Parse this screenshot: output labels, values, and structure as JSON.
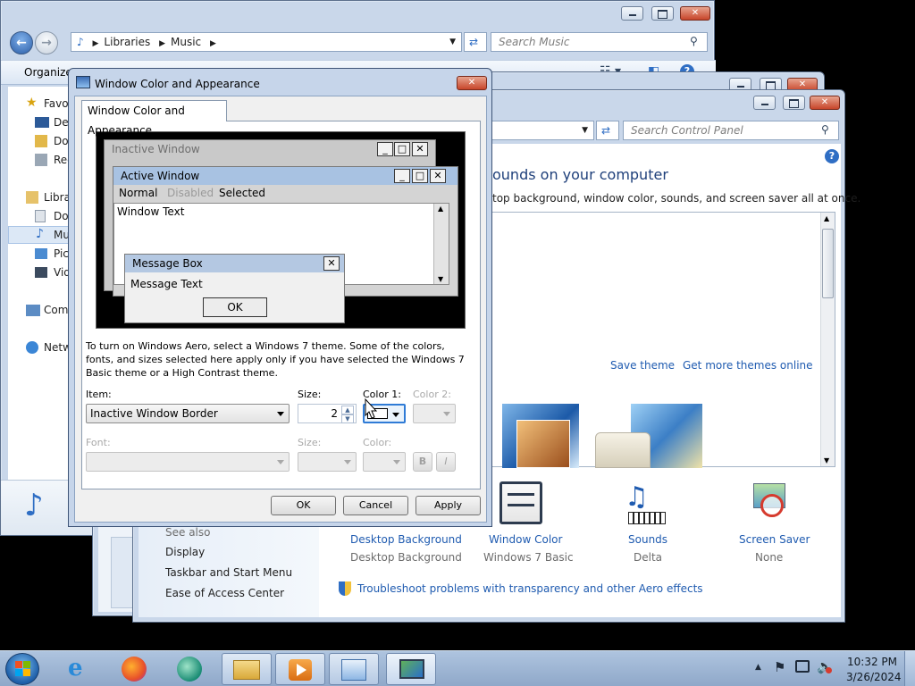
{
  "music_window": {
    "address_path": [
      "Libraries",
      "Music"
    ],
    "search_placeholder": "Search Music",
    "toolbar_organize": "Organize",
    "nav_items": [
      "Favo",
      "Des",
      "Dow",
      "Rec",
      "Libra",
      "Doc",
      "Mus",
      "Pic",
      "Vid",
      "Com",
      "Netw"
    ]
  },
  "personalization": {
    "search_placeholder": "Search Control Panel",
    "heading": "ounds on your computer",
    "subheading": "top background, window color, sounds, and screen saver all at once.",
    "save_theme": "Save theme",
    "get_more_themes": "Get more themes online",
    "see_also": "See also",
    "links": [
      "Display",
      "Taskbar and Start Menu",
      "Ease of Access Center"
    ],
    "bottom_items": [
      {
        "title": "Desktop Background",
        "sub": "Desktop Background",
        "icon": "desktop-background-icon"
      },
      {
        "title": "Window Color",
        "sub": "Windows 7 Basic",
        "icon": "window-color-icon"
      },
      {
        "title": "Sounds",
        "sub": "Delta",
        "icon": "sounds-icon"
      },
      {
        "title": "Screen Saver",
        "sub": "None",
        "icon": "screen-saver-icon"
      }
    ],
    "troubleshoot": "Troubleshoot problems with transparency and other Aero effects"
  },
  "dialog": {
    "title": "Window Color and Appearance",
    "tab": "Window Color and Appearance",
    "preview": {
      "inactive_title": "Inactive Window",
      "active_title": "Active Window",
      "menu_normal": "Normal",
      "menu_disabled": "Disabled",
      "menu_selected": "Selected",
      "window_text": "Window Text",
      "msgbox_title": "Message Box",
      "msgbox_text": "Message Text",
      "msgbox_ok": "OK"
    },
    "info_text": "To turn on Windows Aero, select a Windows 7 theme.  Some of the colors, fonts, and sizes selected here apply only if you have selected the Windows 7 Basic theme or a High Contrast theme.",
    "item_label": "Item:",
    "item_value": "Inactive Window Border",
    "size_label": "Size:",
    "size_value": "2",
    "color1_label": "Color 1:",
    "color2_label": "Color 2:",
    "font_label": "Font:",
    "font_size_label": "Size:",
    "font_color_label": "Color:",
    "bold_label": "B",
    "italic_label": "I",
    "ok": "OK",
    "cancel": "Cancel",
    "apply": "Apply"
  },
  "taskbar": {
    "time": "10:32 PM",
    "date": "3/26/2024",
    "apps": [
      "ie-icon",
      "firefox-icon",
      "chat-icon",
      "explorer-icon",
      "media-player-icon",
      "control-panel-icon",
      "personalization-icon"
    ]
  },
  "colors": {
    "titlebar": "#c6d5ea",
    "link": "#1f5bb0",
    "close": "#c7452a"
  }
}
